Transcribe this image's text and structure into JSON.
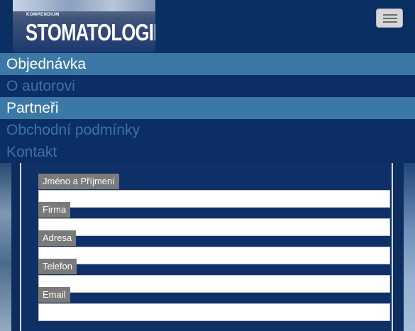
{
  "header": {
    "logo": {
      "small_text": "KOMPENDIUM",
      "title": "STOMATOLOGIE I"
    },
    "menu_toggle_icon": "hamburger-icon"
  },
  "nav": {
    "items": [
      {
        "label": "Objednávka"
      },
      {
        "label": "O autorovi"
      },
      {
        "label": "Partneři"
      },
      {
        "label": "Obchodní podmínky"
      },
      {
        "label": "Kontakt"
      }
    ]
  },
  "form": {
    "fields": [
      {
        "label": "Jméno a Příjmení",
        "value": ""
      },
      {
        "label": "Firma",
        "value": ""
      },
      {
        "label": "Adresa",
        "value": ""
      },
      {
        "label": "Telefon",
        "value": ""
      },
      {
        "label": "Email",
        "value": ""
      }
    ]
  },
  "colors": {
    "background": "#0c2d5e",
    "nav_light": "#3c78a6",
    "nav_dark": "#0b2e64",
    "nav_dark_text": "#3d72a8",
    "label_bg": "#7a7a7a"
  }
}
